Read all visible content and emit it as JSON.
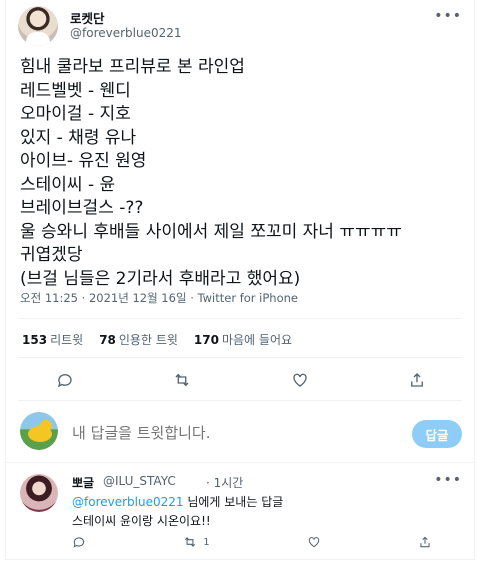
{
  "tweet": {
    "display_name": "로켓단",
    "handle": "@foreverblue0221",
    "more_icon": "more-horizontal-icon",
    "text": "힘내 쿨라보 프리뷰로 본 라인업\n레드벨벳 - 웬디\n오마이걸 - 지호\n있지 - 채령 유나\n아이브- 유진 원영\n스테이씨 - 윤\n브레이브걸스 -??\n울 승와니 후배들 사이에서 제일 쪼꼬미 자너 ㅠㅠㅠㅠ\n귀엽겠당\n (브걸 님들은 2기라서 후배라고 했어요)",
    "time": "오전 11:25",
    "date": "2021년 12월 16일",
    "source": "Twitter for iPhone",
    "separator": "·"
  },
  "stats": {
    "retweets_count": "153",
    "retweets_label": "리트윗",
    "quotes_count": "78",
    "quotes_label": "인용한 트윗",
    "likes_count": "170",
    "likes_label": "마음에 들어요"
  },
  "actions": [
    "reply-icon",
    "retweet-icon",
    "like-icon",
    "share-icon"
  ],
  "composer": {
    "placeholder": "내 답글을 트윗합니다.",
    "button_label": "답글"
  },
  "reply": {
    "name": "뽀글",
    "handle": "@ILU_STAYC",
    "time": "· 1시간",
    "replying_to_handle": "@foreverblue0221",
    "replying_to_suffix": " 님에게 보내는 답글",
    "text": "스테이씨 윤이랑 시온이요!!",
    "retweet_count": "1"
  },
  "colors": {
    "accent": "#1d9bf0",
    "button_disabled": "#8ecdf7",
    "secondary_text": "#536471",
    "divider": "#eff3f4"
  }
}
